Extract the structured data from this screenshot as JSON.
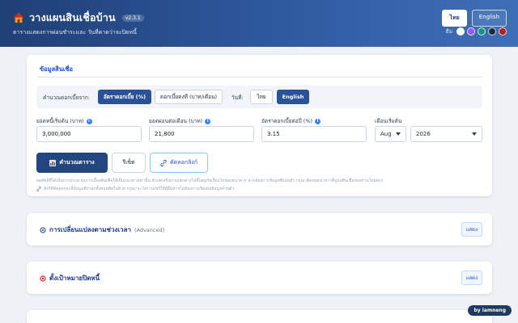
{
  "header": {
    "title": "วางแผนสินเชื่อบ้าน",
    "version": "v2.3.1",
    "subtitle": "ตารางแสดงการผ่อนชำระและ วันที่คาดว่าจะปิดหนี้",
    "lang_buttons": [
      "ไทย",
      "English"
    ],
    "theme_label": "ธีม",
    "theme_colors": [
      "#ffffff",
      "#8b5cf6",
      "#0f9488",
      "#1e293b",
      "#b91c1c"
    ]
  },
  "loan_card": {
    "title": "ข้อมูลสินเชื่อ",
    "mode_label": "คำนวณดอกเบี้ยจาก:",
    "mode_options": [
      "อัตราดอกเบี้ย (%)",
      "ดอกเบี้ยคงที่ (บาท/เดือน)"
    ],
    "date_label": "วันที่:",
    "date_lang_options": [
      "ไทย",
      "English"
    ],
    "principal_label": "ยอดหนี้เริ่มต้น (บาท)",
    "principal_value": "3,000,000",
    "payment_label": "ยอดผ่อนต่อเดือน (บาท)",
    "payment_value": "21,800",
    "rate_label": "อัตราดอกเบี้ยต่อปี (%)",
    "rate_value": "3.15",
    "start_label": "เดือนเริ่มต้น",
    "start_month": "Aug",
    "start_year": "2026",
    "calc_button": "คำนวณตาราง",
    "reset_button": "รีเซ็ต",
    "copy_button": "คัดลอกลิงก์",
    "disclaimer_1": "ผลลัพธ์ที่ได้เป็นการประมาณการเบื้องต้นเพื่อใช้เป็นแนวทางเท่านั้น ตัวเลขจริงอาจแตกต่างไปขึ้นอยู่กับเงื่อนไขของธนาคาร หากต้องการข้อมูลที่แม่นยำ กรุณาติดต่อธนาคารที่ดูแลสินเชื่อของท่านโดยตรง",
    "disclaimer_2": "ลิงก์ที่คัดลอกจะมีข้อมูลที่กรอกทั้งหมดติดไปด้วย กรุณาระวังการแชร์ให้ผู้อื่นหากไม่ต้องการเปิดเผยข้อมูลส่วนตัว"
  },
  "advanced_card": {
    "title": "การเปลี่ยนแปลงตามช่วงเวลา",
    "suffix": "(Advanced)",
    "show_button": "แสดง"
  },
  "goal_card": {
    "title": "ตั้งเป้าหมายปิดหนี้",
    "show_button": "แสดง"
  },
  "footer": {
    "credit": "by iamneng"
  }
}
